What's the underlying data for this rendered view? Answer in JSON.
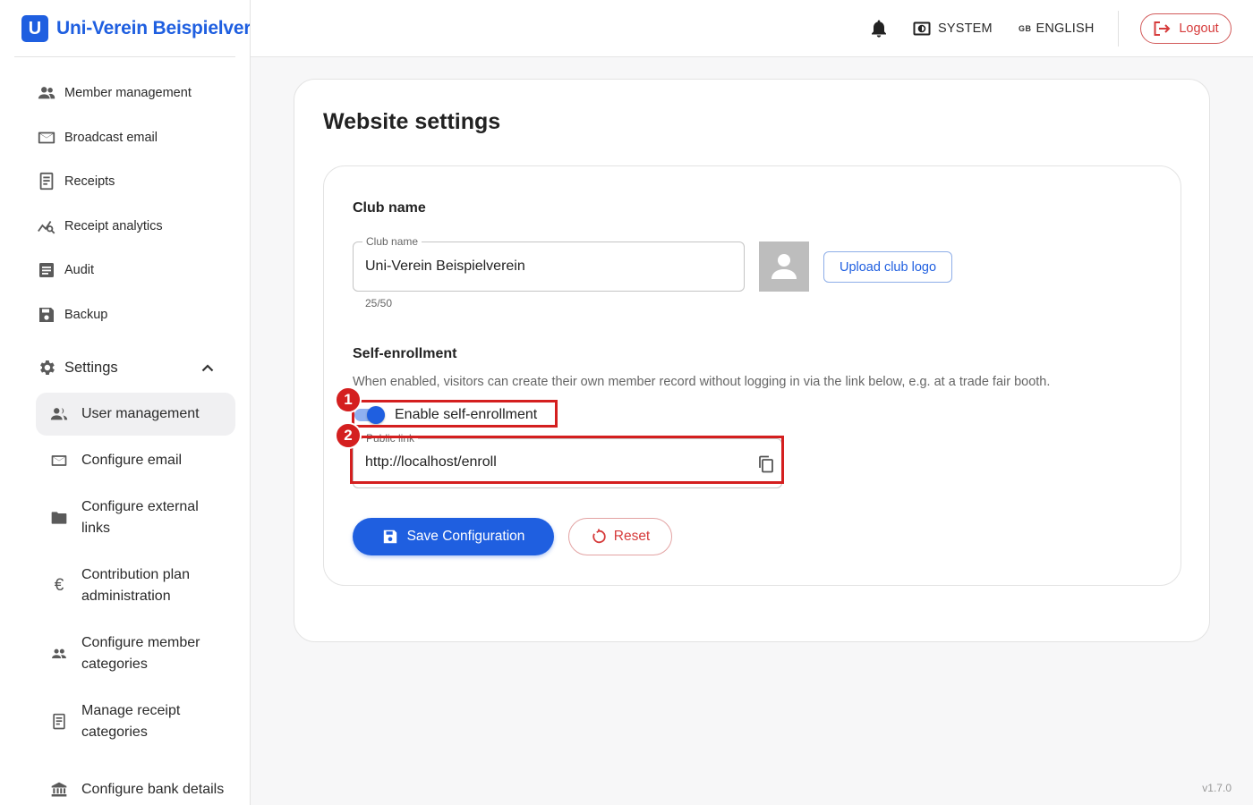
{
  "brand": {
    "badge": "U",
    "title": "Uni-Verein Beispielverein"
  },
  "header": {
    "system_label": "SYSTEM",
    "flag": "GB",
    "language_label": "ENGLISH",
    "logout_label": "Logout"
  },
  "sidebar": {
    "items": [
      {
        "label": "Member management",
        "icon": "people-icon"
      },
      {
        "label": "Broadcast email",
        "icon": "mail-icon"
      },
      {
        "label": "Receipts",
        "icon": "receipt-icon"
      },
      {
        "label": "Receipt analytics",
        "icon": "analytics-icon"
      },
      {
        "label": "Audit",
        "icon": "document-icon"
      },
      {
        "label": "Backup",
        "icon": "save-icon"
      }
    ],
    "settings_label": "Settings",
    "sub_items": [
      {
        "label": "User management",
        "icon": "users-icon",
        "active": true
      },
      {
        "label": "Configure email",
        "icon": "mail-icon"
      },
      {
        "label": "Configure external links",
        "icon": "folder-icon"
      },
      {
        "label": "Contribution plan administration",
        "icon": "euro-icon"
      },
      {
        "label": "Configure member categories",
        "icon": "group-icon"
      },
      {
        "label": "Manage receipt categories",
        "icon": "receipt-icon"
      },
      {
        "label": "Configure bank details",
        "icon": "bank-icon"
      }
    ]
  },
  "main": {
    "title": "Website settings",
    "club_section": {
      "title": "Club name",
      "field_label": "Club name",
      "field_value": "Uni-Verein Beispielverein",
      "counter": "25/50",
      "upload_label": "Upload club logo"
    },
    "enrollment_section": {
      "title": "Self-enrollment",
      "description": "When enabled, visitors can create their own member record without logging in via the link below, e.g. at a trade fair booth.",
      "toggle_label": "Enable self-enrollment",
      "toggle_on": true,
      "link_label": "Public link",
      "link_value": "http://localhost/enroll"
    },
    "save_label": "Save Configuration",
    "reset_label": "Reset"
  },
  "annotations": [
    "1",
    "2"
  ],
  "version": "v1.7.0",
  "colors": {
    "primary": "#1f5fe0",
    "danger": "#d63b3b",
    "annotation": "#d41f1f"
  }
}
